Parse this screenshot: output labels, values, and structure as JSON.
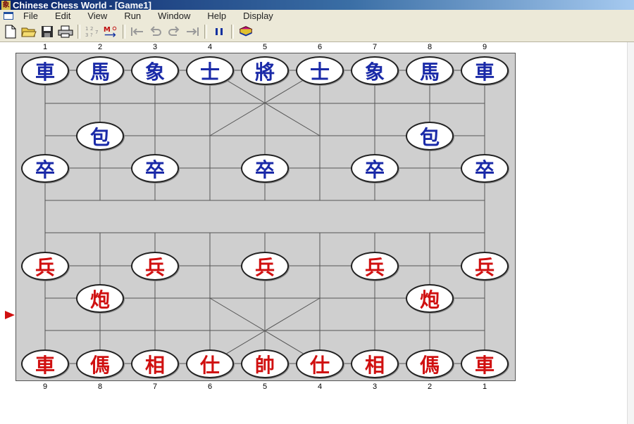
{
  "window": {
    "title": "Chinese Chess World - [Game1]"
  },
  "menu": [
    "File",
    "Edit",
    "View",
    "Run",
    "Window",
    "Help",
    "Display"
  ],
  "toolbar": {
    "buttons": [
      "new-file-icon",
      "open-folder-icon",
      "save-disk-icon",
      "print-icon",
      "sort-moves-icon",
      "move-list-icon",
      "first-move-icon",
      "undo-move-icon",
      "redo-move-icon",
      "last-move-icon",
      "pause-icon",
      "books-icon"
    ]
  },
  "board": {
    "top_files": [
      "1",
      "2",
      "3",
      "4",
      "5",
      "6",
      "7",
      "8",
      "9"
    ],
    "bottom_files": [
      "9",
      "8",
      "7",
      "6",
      "5",
      "4",
      "3",
      "2",
      "1"
    ],
    "blue_back_rank": [
      "車",
      "馬",
      "象",
      "士",
      "將",
      "士",
      "象",
      "馬",
      "車"
    ],
    "blue_cannons": [
      "包",
      "包"
    ],
    "blue_soldiers": [
      "卒",
      "卒",
      "卒",
      "卒",
      "卒"
    ],
    "red_soldiers": [
      "兵",
      "兵",
      "兵",
      "兵",
      "兵"
    ],
    "red_cannons": [
      "炮",
      "炮"
    ],
    "red_back_rank": [
      "車",
      "傌",
      "相",
      "仕",
      "帥",
      "仕",
      "相",
      "傌",
      "車"
    ]
  },
  "colors": {
    "blue_piece": "#1a2aa8",
    "red_piece": "#d01010",
    "board": "#cfcfcf"
  }
}
